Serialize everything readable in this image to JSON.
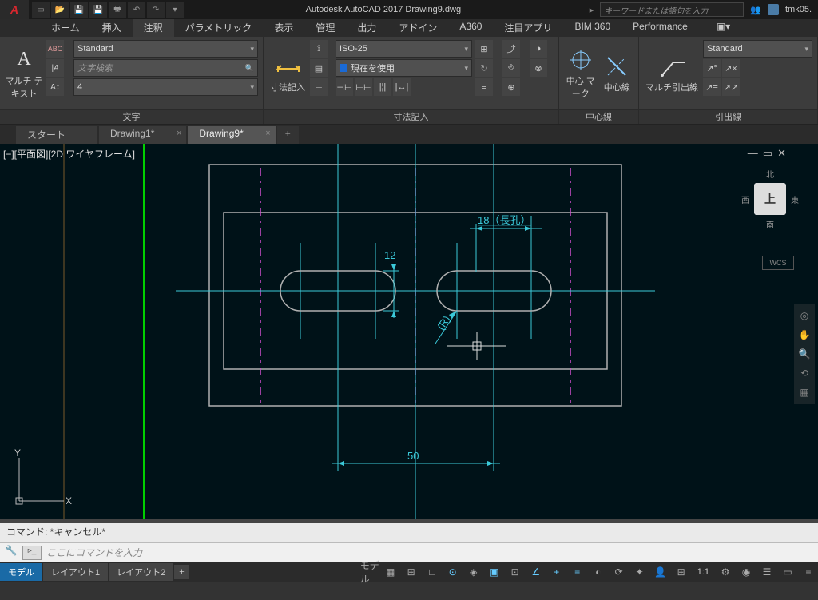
{
  "title": {
    "prefix": "Autodesk AutoCAD 2017   ",
    "doc": "Drawing9.dwg"
  },
  "search_placeholder": "キーワードまたは語句を入力",
  "user_name": "tmk05.",
  "ribbon_tabs": [
    "ホーム",
    "挿入",
    "注釈",
    "パラメトリック",
    "表示",
    "管理",
    "出力",
    "アドイン",
    "A360",
    "注目アプリ",
    "BIM 360",
    "Performance"
  ],
  "ribbon_active_tab": 2,
  "panel_text": {
    "multi_text": "マルチ テキスト",
    "text_panel": "文字",
    "style_combo": "Standard",
    "search_combo": "文字検索",
    "height_combo": "4",
    "dim_big": "寸法記入",
    "dim_panel": "寸法記入",
    "dim_style": "ISO-25",
    "dim_layer": "現在を使用",
    "center_mark": "中心 マーク",
    "center_line": "中心線",
    "center_panel": "中心線",
    "mleader": "マルチ引出線",
    "mleader_panel": "引出線",
    "mleader_style": "Standard"
  },
  "file_tabs": [
    {
      "label": "スタート",
      "active": false,
      "closable": false
    },
    {
      "label": "Drawing1*",
      "active": false,
      "closable": true
    },
    {
      "label": "Drawing9*",
      "active": true,
      "closable": true
    }
  ],
  "viewport_label": "[−][平面図][2D ワイヤフレーム]",
  "viewcube": {
    "n": "北",
    "s": "南",
    "e": "東",
    "w": "西",
    "top": "上"
  },
  "wcs": "WCS",
  "ucs": {
    "x": "X",
    "y": "Y"
  },
  "dimensions": {
    "width_50": "50",
    "height_12": "12",
    "slot_18": "18（長孔）",
    "radius": "(R)"
  },
  "cmd": {
    "history": "コマンド: *キャンセル*",
    "placeholder": "ここにコマンドを入力"
  },
  "status": {
    "tabs": [
      "モデル",
      "レイアウト1",
      "レイアウト2"
    ],
    "active_tab": 0,
    "scale": "1:1",
    "plus": "+"
  }
}
